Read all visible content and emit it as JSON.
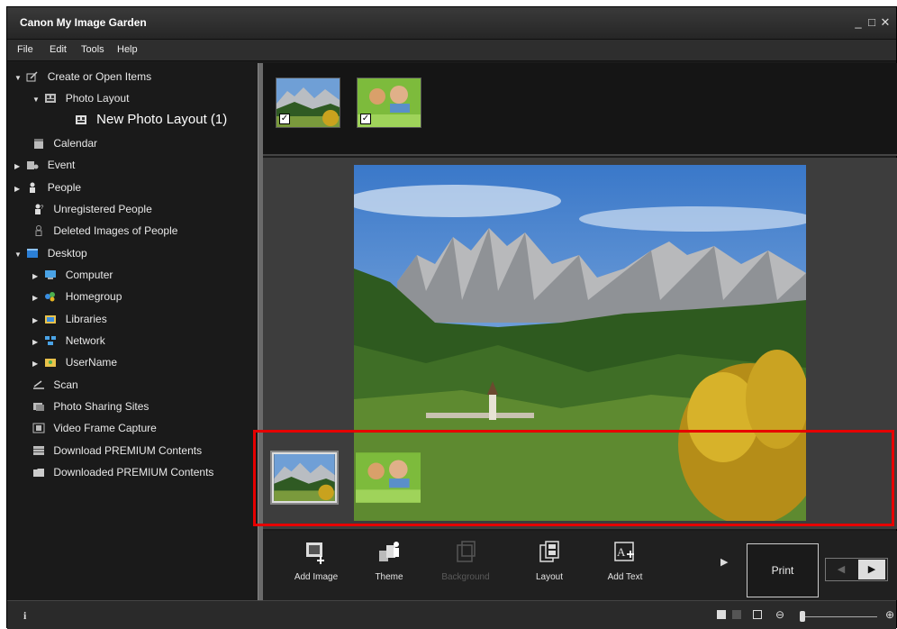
{
  "window": {
    "title": "Canon My Image Garden",
    "controls": [
      "_",
      "□",
      "✕"
    ]
  },
  "menu": [
    "File",
    "Edit",
    "Tools",
    "Help"
  ],
  "sidebar": {
    "items": [
      {
        "label": "Create or Open Items",
        "expanded": true,
        "icon": "create-items-icon"
      },
      {
        "label": "Photo Layout",
        "expanded": true,
        "icon": "photo-layout-icon"
      },
      {
        "label": "New Photo Layout (1)",
        "selected": true,
        "icon": "layout-doc-icon"
      },
      {
        "label": "Calendar",
        "icon": "calendar-icon"
      },
      {
        "label": "Event",
        "collapsed": true,
        "icon": "event-icon"
      },
      {
        "label": "People",
        "collapsed": true,
        "icon": "people-icon"
      },
      {
        "label": "Unregistered People",
        "icon": "unregistered-people-icon"
      },
      {
        "label": "Deleted Images of People",
        "icon": "deleted-people-icon"
      },
      {
        "label": "Desktop",
        "expanded": true,
        "icon": "desktop-icon"
      },
      {
        "label": "Computer",
        "collapsed": true,
        "icon": "computer-icon"
      },
      {
        "label": "Homegroup",
        "collapsed": true,
        "icon": "homegroup-icon"
      },
      {
        "label": "Libraries",
        "collapsed": true,
        "icon": "libraries-icon"
      },
      {
        "label": "Network",
        "collapsed": true,
        "icon": "network-icon"
      },
      {
        "label": "UserName",
        "collapsed": true,
        "icon": "user-folder-icon"
      },
      {
        "label": "Scan",
        "icon": "scan-icon"
      },
      {
        "label": "Photo Sharing Sites",
        "icon": "photo-sharing-icon"
      },
      {
        "label": "Video Frame Capture",
        "icon": "video-frame-icon"
      },
      {
        "label": "Download PREMIUM Contents",
        "icon": "download-premium-icon"
      },
      {
        "label": "Downloaded PREMIUM Contents",
        "icon": "downloaded-premium-icon"
      }
    ]
  },
  "toolbar": {
    "add_image": "Add Image",
    "theme": "Theme",
    "background": "Background",
    "layout": "Layout",
    "add_text": "Add Text",
    "print": "Print"
  },
  "colors": {
    "highlight": "#e60000",
    "background": "#1b1b1b",
    "accent_sidebar_text": "#e8e8e8"
  }
}
